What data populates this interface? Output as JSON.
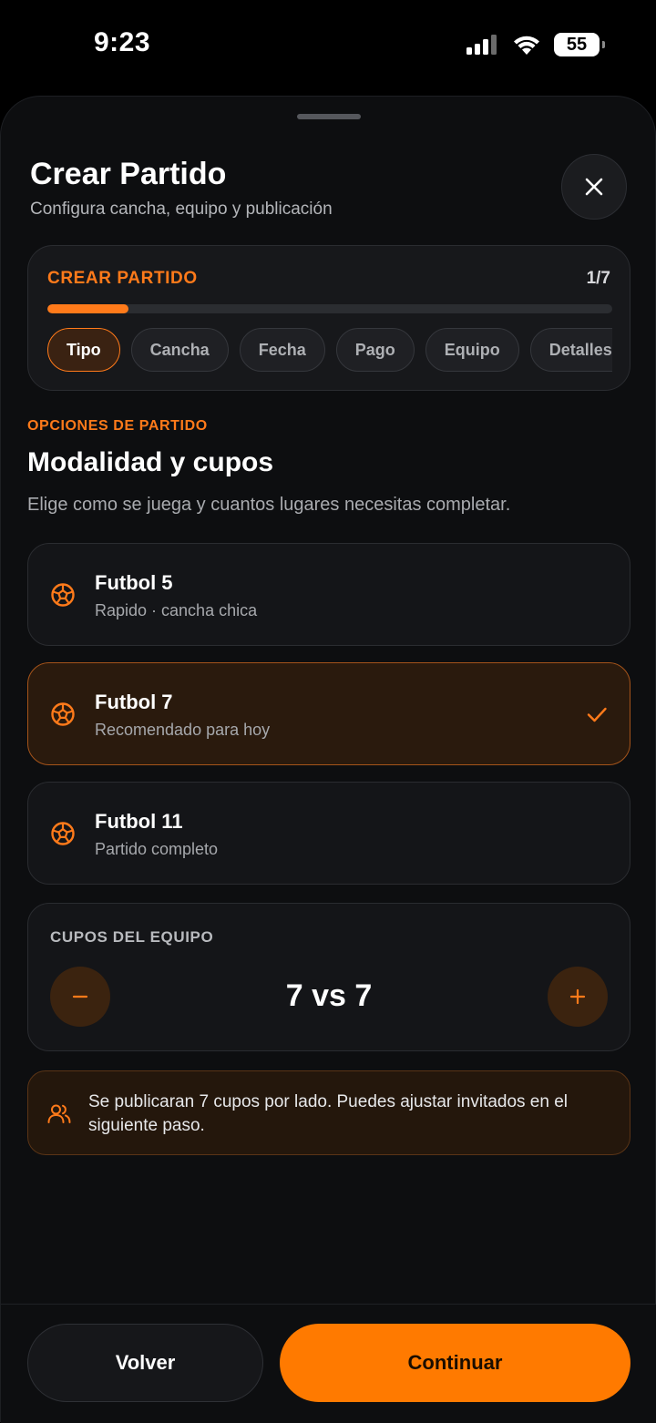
{
  "status_bar": {
    "time": "9:23",
    "battery": "55"
  },
  "sheet": {
    "title": "Crear Partido",
    "subtitle": "Configura cancha, equipo y publicación"
  },
  "progress": {
    "label": "CREAR PARTIDO",
    "count": "1/7",
    "fraction": 0.143,
    "steps": [
      "Tipo",
      "Cancha",
      "Fecha",
      "Pago",
      "Equipo",
      "Detalles"
    ],
    "active_step": "Tipo"
  },
  "section": {
    "eyebrow": "OPCIONES DE PARTIDO",
    "title": "Modalidad y cupos",
    "description": "Elige como se juega y cuantos lugares necesitas completar."
  },
  "options": [
    {
      "title": "Futbol 5",
      "subtitle": "Rapido · cancha chica",
      "selected": false
    },
    {
      "title": "Futbol 7",
      "subtitle": "Recomendado para hoy",
      "selected": true
    },
    {
      "title": "Futbol 11",
      "subtitle": "Partido completo",
      "selected": false
    }
  ],
  "quota": {
    "label": "CUPOS DEL EQUIPO",
    "value": "7 vs 7"
  },
  "info": {
    "text": "Se publicaran 7 cupos por lado. Puedes ajustar invitados en el siguiente paso."
  },
  "actions": {
    "back_label": "Volver",
    "continue_label": "Continuar"
  },
  "colors": {
    "accent": "#ff7a1a",
    "button_primary": "#ff7a00",
    "background": "#0d0e10",
    "card": "#141518",
    "selected_card": "#2a1a0d"
  },
  "icons": {
    "close": "close-icon",
    "option": "soccer-ball-icon",
    "selected": "checkmark-icon",
    "minus": "minus-icon",
    "plus": "plus-icon",
    "info": "people-icon"
  }
}
